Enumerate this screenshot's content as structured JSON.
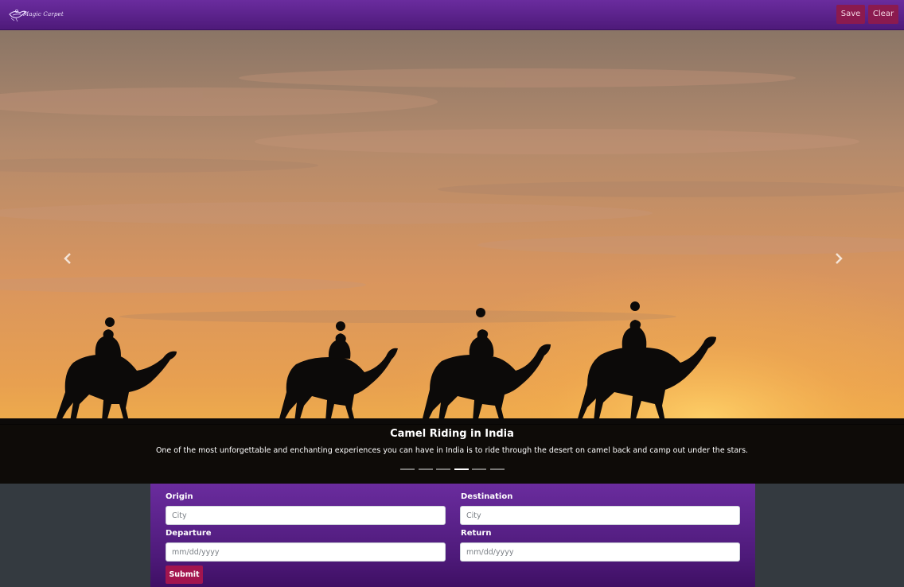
{
  "navbar": {
    "logo_icon": "magic-carpet-lamp-icon",
    "logo_text": "Magic Carpet",
    "save_label": "Save",
    "clear_label": "Clear",
    "colors": {
      "bar": "#5a2288",
      "button": "#8b1a4f"
    }
  },
  "carousel": {
    "prev_icon": "chevron-left-icon",
    "next_icon": "chevron-right-icon",
    "slide": {
      "title": "Camel Riding in India",
      "description": "One of the most unforgettable and enchanting experiences you can have in India is to ride through the desert on camel back and camp out under the stars."
    },
    "indicators": [
      {
        "active": false
      },
      {
        "active": false
      },
      {
        "active": false
      },
      {
        "active": true
      },
      {
        "active": false
      },
      {
        "active": false
      }
    ]
  },
  "search_form": {
    "origin_label": "Origin",
    "origin_placeholder": "City",
    "destination_label": "Destination",
    "destination_placeholder": "City",
    "departure_label": "Departure",
    "departure_placeholder": "mm/dd/yyyy",
    "return_label": "Return",
    "return_placeholder": "mm/dd/yyyy",
    "submit_label": "Submit",
    "colors": {
      "panel": "#5a2288",
      "submit": "#a3154e"
    }
  }
}
